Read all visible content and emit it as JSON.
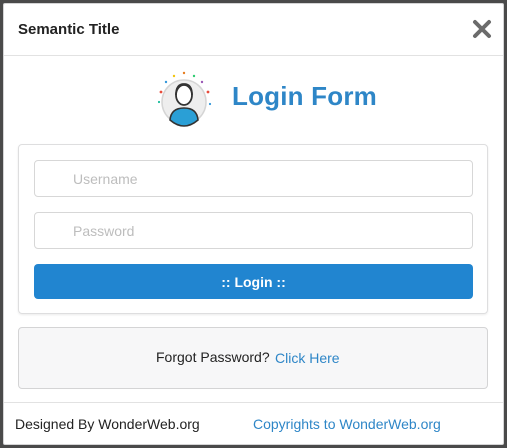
{
  "modal": {
    "title": "Semantic Title",
    "close_icon": "close-icon"
  },
  "brand": {
    "title": "Login Form",
    "logo_icon": "user-avatar-icon"
  },
  "form": {
    "username_placeholder": "Username",
    "password_placeholder": "Password",
    "login_label": ":: Login ::"
  },
  "forgot": {
    "text": "Forgot Password?",
    "link": "Click Here"
  },
  "footer": {
    "left": "Designed By WonderWeb.org",
    "right": "Copyrights to WonderWeb.org"
  },
  "colors": {
    "accent": "#2185d0",
    "brand_text": "#2e86c7",
    "panel_bg": "#f7f7f8",
    "overlay": "#4a4a4a"
  }
}
